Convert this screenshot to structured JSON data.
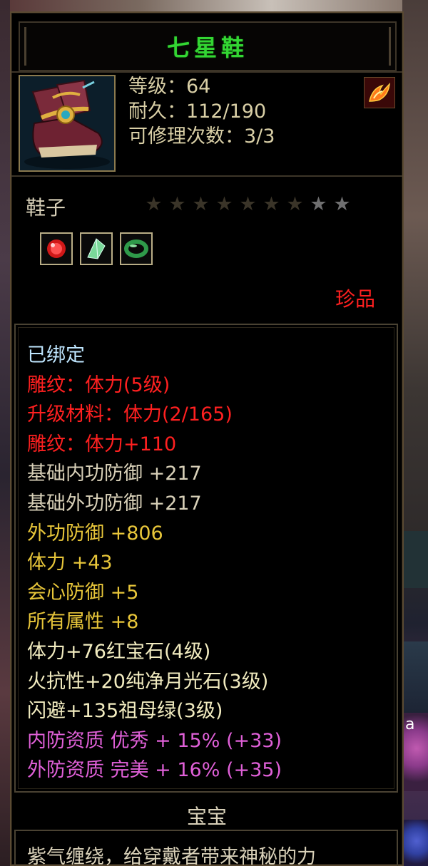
{
  "item": {
    "name": "七星鞋",
    "stats": [
      "等级：64",
      "耐久：112/190",
      "可修理次数：3/3"
    ],
    "type": "鞋子",
    "stars_total": 9,
    "stars_lit": 2,
    "gems": [
      {
        "icon": "red-gem-icon",
        "color": "#d01818"
      },
      {
        "icon": "green-crystal-icon",
        "color": "#7ad89a"
      },
      {
        "icon": "jade-ring-icon",
        "color": "#2f9a4a"
      }
    ],
    "rarity": "珍品"
  },
  "attributes": [
    {
      "text": "已绑定",
      "color": "#bfe6ff"
    },
    {
      "text": "雕纹：体力(5级)",
      "color": "#ff2020"
    },
    {
      "text": "升级材料：体力(2/165)",
      "color": "#ff2020"
    },
    {
      "text": "雕纹：体力+110",
      "color": "#ff2020"
    },
    {
      "text": "基础内功防御 +217",
      "color": "#d8d0b8"
    },
    {
      "text": "基础外功防御 +217",
      "color": "#d8d0b8"
    },
    {
      "text": "外功防御 +806",
      "color": "#e8c63a"
    },
    {
      "text": "体力 +43",
      "color": "#e8c63a"
    },
    {
      "text": "会心防御 +5",
      "color": "#e8c63a"
    },
    {
      "text": "所有属性 +8",
      "color": "#e8c63a"
    },
    {
      "text": "体力+76红宝石(4级)",
      "color": "#f2ecc0"
    },
    {
      "text": "火抗性+20纯净月光石(3级)",
      "color": "#f2ecc0"
    },
    {
      "text": "闪避+135祖母绿(3级)",
      "color": "#f2ecc0"
    },
    {
      "text": "内防资质 优秀 + 15% (+33)",
      "color": "#e060d8"
    },
    {
      "text": "外防资质 完美 + 16% (+35)",
      "color": "#e060d8"
    }
  ],
  "footer": {
    "label": "宝宝",
    "description": "紫气缠绕，给穿戴者带来神秘的力"
  },
  "colors": {
    "title": "#33d633",
    "frame": "#5a4a32",
    "rarity": "#ff2020"
  },
  "icons": {
    "item": "boot-icon",
    "badge": "fire-wing-icon",
    "star": "star-icon"
  }
}
